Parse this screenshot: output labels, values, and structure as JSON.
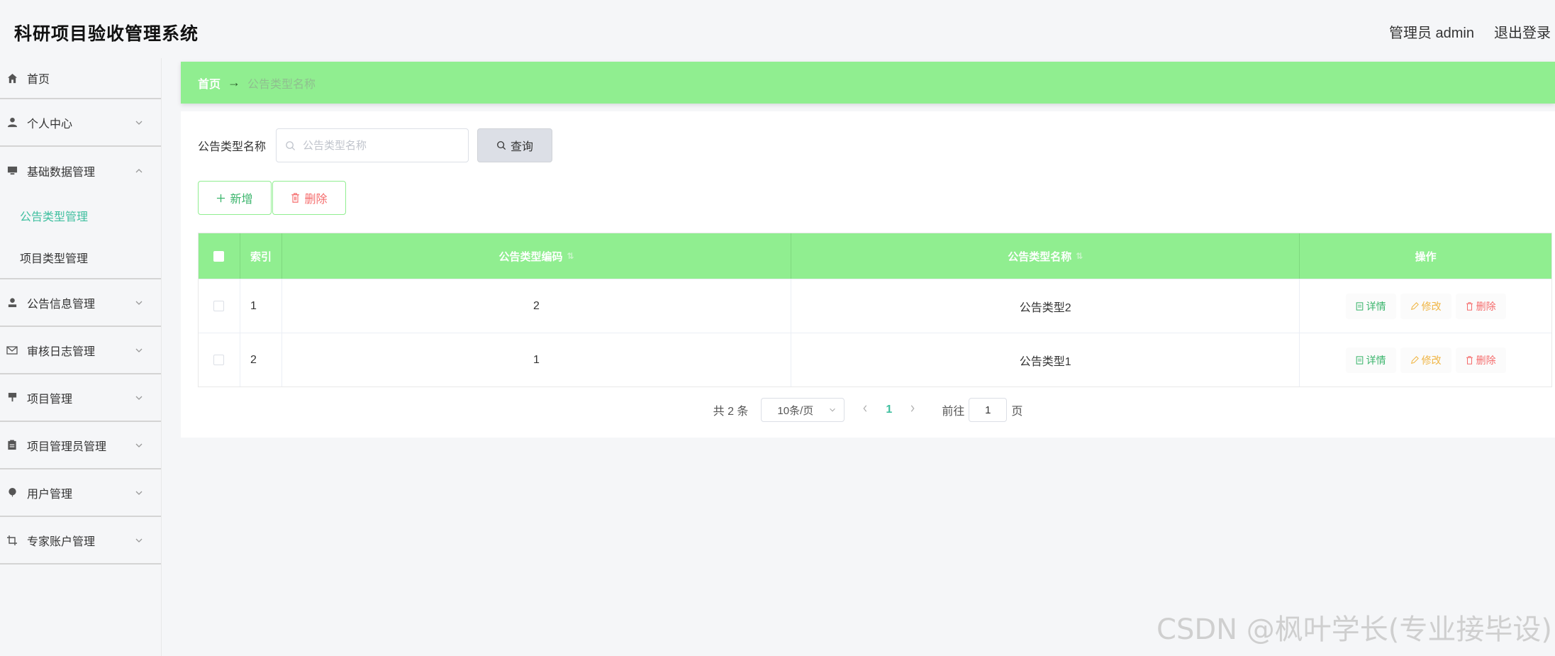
{
  "header": {
    "title": "科研项目验收管理系统",
    "user_label": "管理员 admin",
    "logout_label": "退出登录"
  },
  "sidebar": {
    "items": [
      {
        "label": "首页",
        "icon": "home-icon"
      },
      {
        "label": "个人中心",
        "icon": "user-icon"
      },
      {
        "label": "基础数据管理",
        "icon": "monitor-icon",
        "expanded": true,
        "children": [
          {
            "label": "公告类型管理",
            "active": true
          },
          {
            "label": "项目类型管理"
          }
        ]
      },
      {
        "label": "公告信息管理",
        "icon": "person-icon"
      },
      {
        "label": "审核日志管理",
        "icon": "mail-icon"
      },
      {
        "label": "项目管理",
        "icon": "stamp-icon"
      },
      {
        "label": "项目管理员管理",
        "icon": "clipboard-icon"
      },
      {
        "label": "用户管理",
        "icon": "balloon-icon"
      },
      {
        "label": "专家账户管理",
        "icon": "crop-icon"
      }
    ]
  },
  "breadcrumb": {
    "home": "首页",
    "arrow": "→",
    "current": "公告类型名称"
  },
  "search": {
    "label": "公告类型名称",
    "placeholder": "公告类型名称",
    "value": "",
    "button": "查询"
  },
  "actions": {
    "add": "新增",
    "delete": "删除"
  },
  "table": {
    "columns": [
      "索引",
      "公告类型编码",
      "公告类型名称",
      "操作"
    ],
    "rows": [
      {
        "index": "1",
        "code": "2",
        "name": "公告类型2"
      },
      {
        "index": "2",
        "code": "1",
        "name": "公告类型1"
      }
    ],
    "ops": {
      "detail": "详情",
      "edit": "修改",
      "delete": "删除"
    }
  },
  "pagination": {
    "total": "共 2 条",
    "page_size": "10条/页",
    "current": "1",
    "goto_label": "前往",
    "goto_value": "1",
    "page_suffix": "页"
  },
  "watermark": "CSDN @枫叶学长(专业接毕设)",
  "colors": {
    "accent": "#90ee90",
    "active_text": "#3fbf9f",
    "danger": "#f56c6c",
    "warning": "#f0b544",
    "success": "#3bb56c"
  }
}
